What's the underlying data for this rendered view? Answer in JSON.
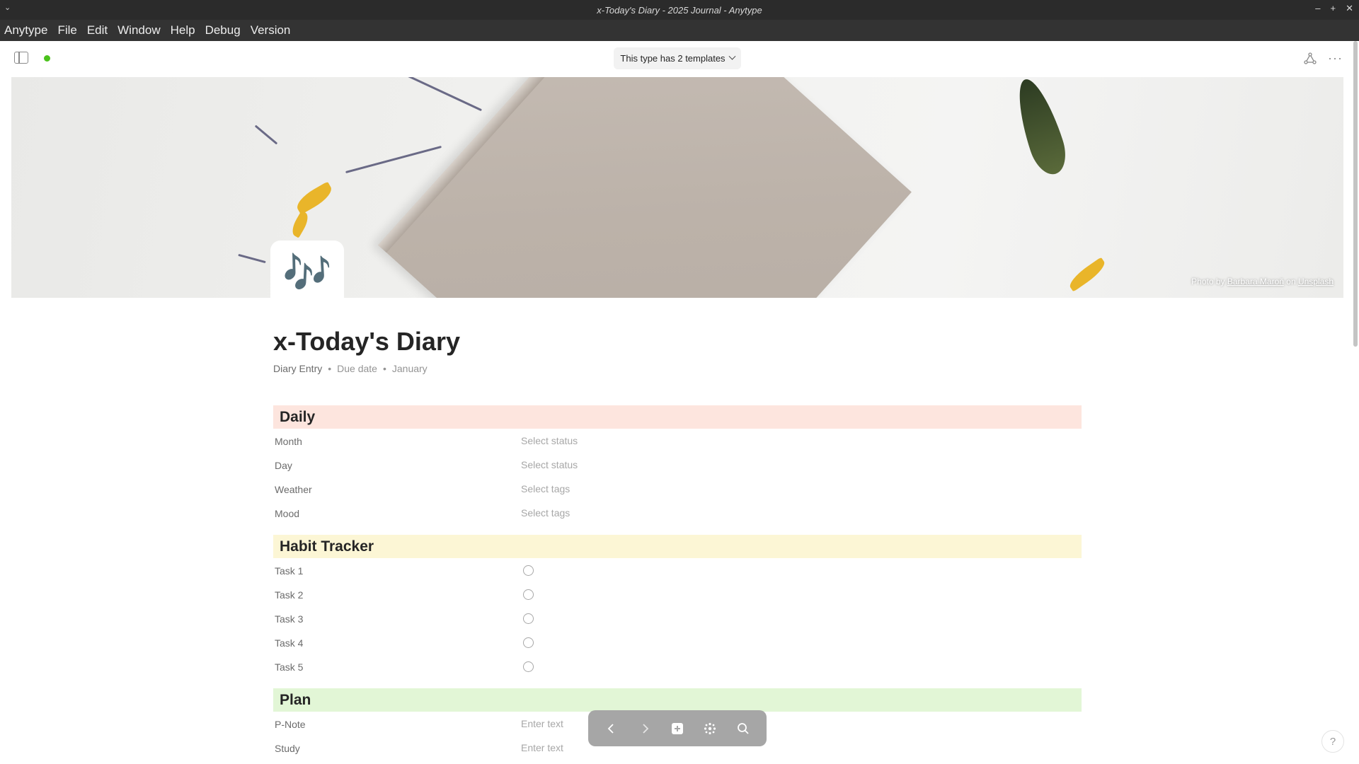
{
  "window": {
    "title": "x-Today's Diary - 2025 Journal - Anytype",
    "controls": [
      "–",
      "+",
      "✕"
    ]
  },
  "menubar": [
    "Anytype",
    "File",
    "Edit",
    "Window",
    "Help",
    "Debug",
    "Version"
  ],
  "header": {
    "template_label": "This type has 2 templates"
  },
  "cover": {
    "credit_prefix": "Photo by",
    "author": "Barbara Maroň",
    "credit_on": "on",
    "source": "Unsplash"
  },
  "page": {
    "icon": "🎶",
    "title": "x-Today's Diary",
    "featured": {
      "type": "Diary Entry",
      "due_date": "Due date",
      "month": "January"
    }
  },
  "sections": {
    "daily": {
      "title": "Daily",
      "color": "#fde5de",
      "rows": [
        {
          "label": "Month",
          "value": "Select status"
        },
        {
          "label": "Day",
          "value": "Select status"
        },
        {
          "label": "Weather",
          "value": "Select tags"
        },
        {
          "label": "Mood",
          "value": "Select tags"
        }
      ]
    },
    "habit": {
      "title": "Habit Tracker",
      "color": "#fcf6d5",
      "rows": [
        {
          "label": "Task 1",
          "checked": false
        },
        {
          "label": "Task 2",
          "checked": false
        },
        {
          "label": "Task 3",
          "checked": false
        },
        {
          "label": "Task 4",
          "checked": false
        },
        {
          "label": "Task 5",
          "checked": false
        }
      ]
    },
    "plan": {
      "title": "Plan",
      "color": "#e2f6d6",
      "rows": [
        {
          "label": "P-Note",
          "value": "Enter text"
        },
        {
          "label": "Study",
          "value": "Enter text"
        }
      ]
    }
  },
  "help": "?"
}
